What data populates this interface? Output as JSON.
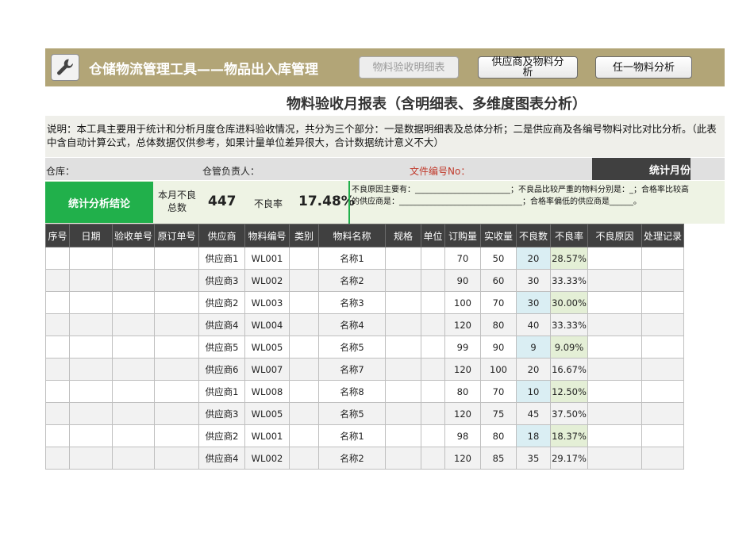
{
  "header": {
    "title": "仓储物流管理工具——物品出入库管理",
    "logo_icon": "wrench-icon",
    "bar_color": "#b2a577",
    "buttons": [
      {
        "label": "物料验收明细表",
        "state": "disabled"
      },
      {
        "label": "供应商及物料分析",
        "state": "normal"
      },
      {
        "label": "任一物料分析",
        "state": "normal"
      }
    ]
  },
  "report_title": "物料验收月报表（含明细表、多维度图表分析）",
  "description": "说明：本工具主要用于统计和分析月度仓库进料验收情况，共分为三个部分：一是数据明细表及总体分析；二是供应商及各编号物料对比对比分析。（此表中含自动计算公式，总体数据仅供参考，如果计量单位差异很大，合计数据统计意义不大）",
  "info": {
    "warehouse_label": "仓库：",
    "manager_label": "仓管负责人：",
    "doc_no_label": "文件编号No：",
    "month_label": "统计月份"
  },
  "summary": {
    "conclusion_label": "统计分析结论",
    "defect_total_label": "本月不良总数",
    "defect_total_value": "447",
    "defect_rate_label": "不良率",
    "defect_rate_value": "17.48%",
    "notes": "不良原因主要有：________________________；不良品比较严重的物料分别是：_；合格率比较高的供应商是：_______________________________；合格率偏低的供应商是______。"
  },
  "table": {
    "columns": [
      "序号",
      "日期",
      "验收单号",
      "原订单号",
      "供应商",
      "物料编号",
      "类别",
      "物料名称",
      "规格",
      "单位",
      "订购量",
      "实收量",
      "不良数",
      "不良率",
      "不良原因",
      "处理记录"
    ],
    "rows": [
      {
        "supplier": "供应商1",
        "code": "WL001",
        "name": "名称1",
        "ordered": "70",
        "received": "50",
        "defects": "20",
        "rate": "28.57%"
      },
      {
        "supplier": "供应商3",
        "code": "WL002",
        "name": "名称2",
        "ordered": "90",
        "received": "60",
        "defects": "30",
        "rate": "33.33%"
      },
      {
        "supplier": "供应商2",
        "code": "WL003",
        "name": "名称3",
        "ordered": "100",
        "received": "70",
        "defects": "30",
        "rate": "30.00%"
      },
      {
        "supplier": "供应商4",
        "code": "WL004",
        "name": "名称4",
        "ordered": "120",
        "received": "80",
        "defects": "40",
        "rate": "33.33%"
      },
      {
        "supplier": "供应商5",
        "code": "WL005",
        "name": "名称5",
        "ordered": "99",
        "received": "90",
        "defects": "9",
        "rate": "9.09%"
      },
      {
        "supplier": "供应商6",
        "code": "WL007",
        "name": "名称7",
        "ordered": "120",
        "received": "100",
        "defects": "20",
        "rate": "16.67%"
      },
      {
        "supplier": "供应商1",
        "code": "WL008",
        "name": "名称8",
        "ordered": "80",
        "received": "70",
        "defects": "10",
        "rate": "12.50%"
      },
      {
        "supplier": "供应商3",
        "code": "WL005",
        "name": "名称5",
        "ordered": "120",
        "received": "75",
        "defects": "45",
        "rate": "37.50%"
      },
      {
        "supplier": "供应商2",
        "code": "WL001",
        "name": "名称1",
        "ordered": "98",
        "received": "80",
        "defects": "18",
        "rate": "18.37%"
      },
      {
        "supplier": "供应商4",
        "code": "WL002",
        "name": "名称2",
        "ordered": "120",
        "received": "85",
        "defects": "35",
        "rate": "29.17%"
      }
    ]
  },
  "colors": {
    "accent_green": "#21b04b",
    "table_header": "#404040",
    "defect_col": "#daeef3",
    "rate_col": "#e4efd6",
    "doc_no_red": "#c0392b"
  }
}
